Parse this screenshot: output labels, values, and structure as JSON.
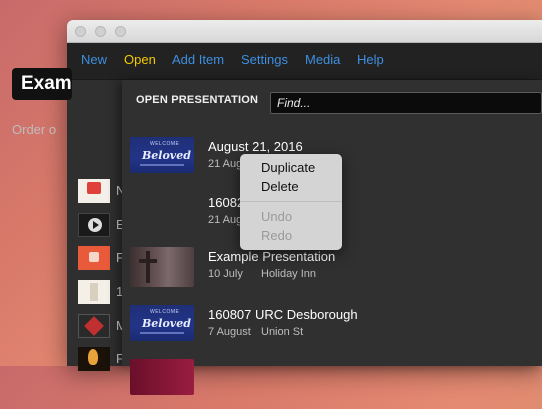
{
  "menubar": {
    "items": [
      "New",
      "Open",
      "Add Item",
      "Settings",
      "Media",
      "Help"
    ]
  },
  "background": {
    "name_field_value": "Exam",
    "order_label": "Order o",
    "side_items": [
      "N",
      "E",
      "F",
      "1",
      "M",
      "F"
    ]
  },
  "panel": {
    "heading": "OPEN PRESENTATION",
    "find_placeholder": "Find...",
    "presentations": [
      {
        "title": "August 21, 2016",
        "date": "21 August",
        "location": ""
      },
      {
        "title": "16082",
        "date": "21 Augu",
        "location": ""
      },
      {
        "title": "Example Presentation",
        "date": "10 July",
        "location": "Holiday Inn"
      },
      {
        "title": "160807 URC Desborough",
        "date": "7 August",
        "location": "Union St"
      }
    ],
    "thumb_text": {
      "top": "WELCOME",
      "word": "Beloved"
    }
  },
  "context_menu": {
    "items": [
      "Duplicate",
      "Delete",
      "Undo",
      "Redo"
    ]
  },
  "colors": {
    "menu_link": "#3d8fe0",
    "menu_active": "#f2cc00",
    "panel_bg": "#303030",
    "window_bg": "#2a2a2a"
  }
}
